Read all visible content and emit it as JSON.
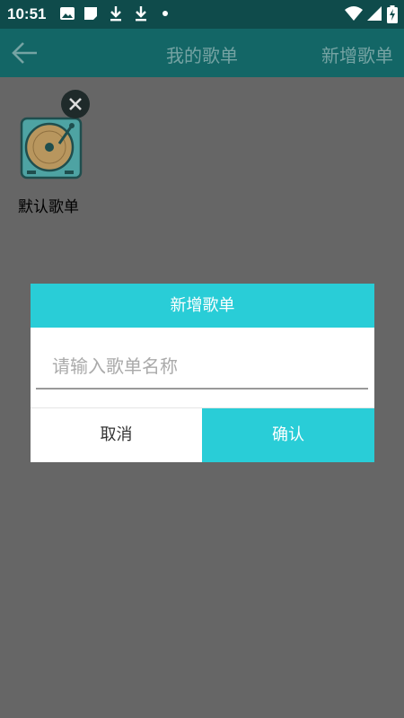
{
  "status_bar": {
    "time": "10:51",
    "icons": [
      "image-icon",
      "note-icon",
      "download-icon",
      "download-icon",
      "dot-icon",
      "wifi-icon",
      "signal-icon",
      "battery-icon"
    ]
  },
  "toolbar": {
    "back_icon": "arrow-left-icon",
    "title": "我的歌单",
    "action_label": "新增歌单"
  },
  "playlists": [
    {
      "name": "默认歌单",
      "icon": "turntable-icon",
      "delete_icon": "close-icon"
    }
  ],
  "dialog": {
    "title": "新增歌单",
    "input_placeholder": "请输入歌单名称",
    "input_value": "",
    "cancel_label": "取消",
    "confirm_label": "确认"
  },
  "colors": {
    "status_bar": "#0f4b4b",
    "toolbar": "#136666",
    "toolbar_text": "#75a3a3",
    "overlay": "#666666",
    "accent": "#29cdd7"
  }
}
